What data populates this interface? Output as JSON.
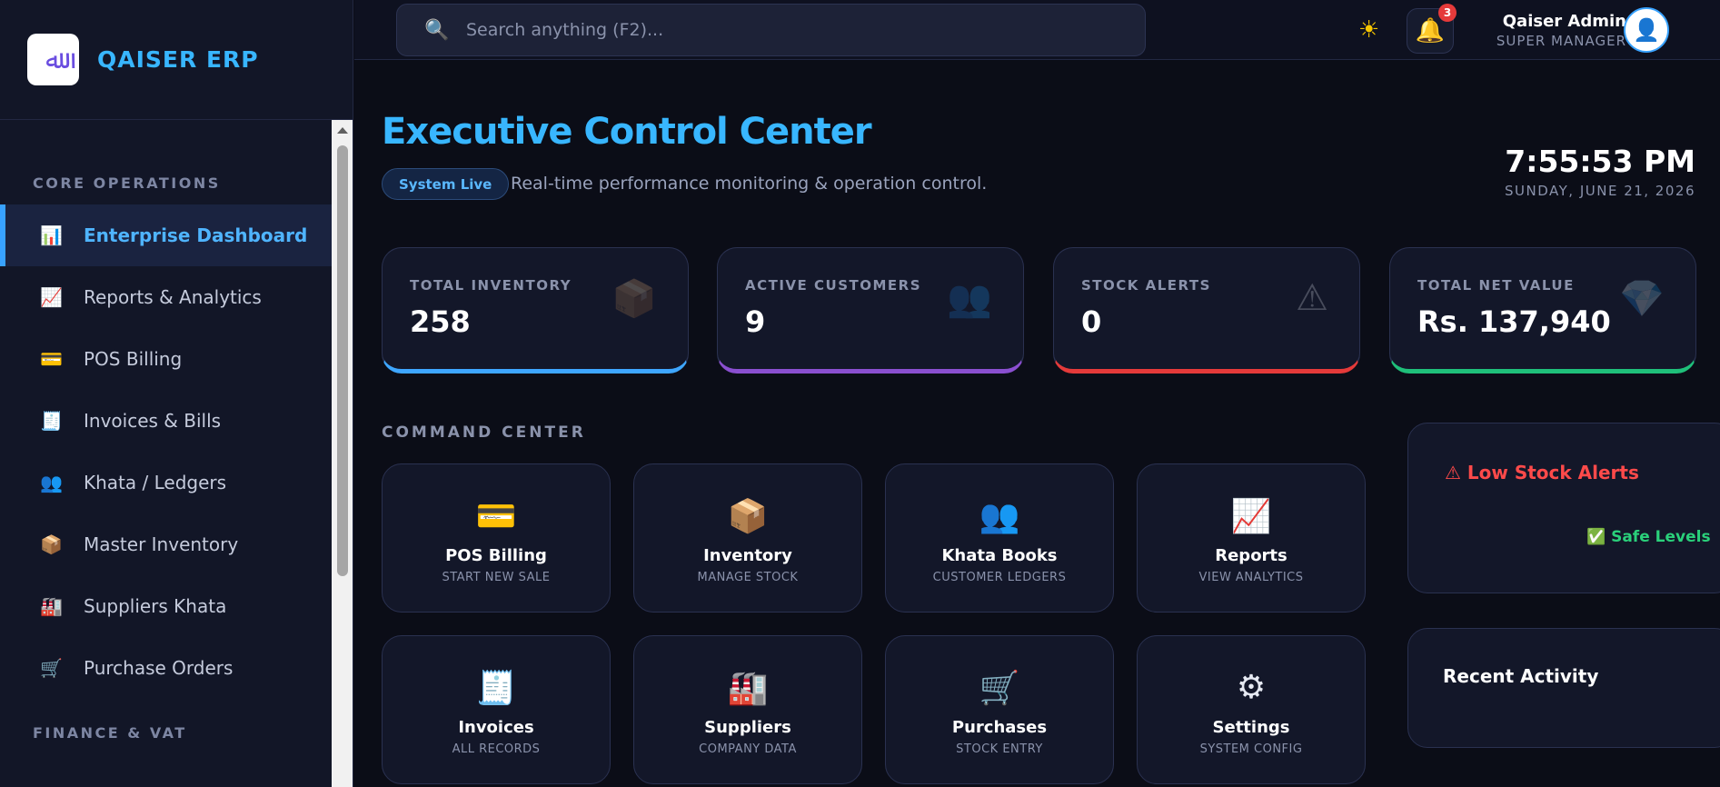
{
  "brand": {
    "logo_glyph": "ﷲ",
    "name": "QAISER ERP"
  },
  "sidebar": {
    "sections": [
      {
        "title": "CORE OPERATIONS",
        "items": [
          {
            "icon": "📊",
            "icon_name": "bar-chart-icon",
            "label": "Enterprise Dashboard",
            "active": true
          },
          {
            "icon": "📈",
            "icon_name": "trend-chart-icon",
            "label": "Reports & Analytics"
          },
          {
            "icon": "💳",
            "icon_name": "credit-card-icon",
            "label": "POS Billing"
          },
          {
            "icon": "🧾",
            "icon_name": "receipt-icon",
            "label": "Invoices & Bills"
          },
          {
            "icon": "👥",
            "icon_name": "people-icon",
            "label": "Khata / Ledgers"
          },
          {
            "icon": "📦",
            "icon_name": "package-icon",
            "label": "Master Inventory"
          },
          {
            "icon": "🏭",
            "icon_name": "factory-icon",
            "label": "Suppliers Khata"
          },
          {
            "icon": "🛒",
            "icon_name": "cart-icon",
            "label": "Purchase Orders"
          }
        ]
      },
      {
        "title": "FINANCE & VAT",
        "items": []
      }
    ]
  },
  "topbar": {
    "search_placeholder": "Search anything (F2)...",
    "notifications_count": "3",
    "user_name": "Qaiser Admin",
    "user_role": "SUPER MANAGER"
  },
  "header": {
    "title": "Executive Control Center",
    "status_badge": "System Live",
    "subtitle": "Real-time performance monitoring & operation control.",
    "time": "7:55:53 PM",
    "date": "SUNDAY, JUNE 21, 2026"
  },
  "stats": [
    {
      "label": "TOTAL INVENTORY",
      "value": "258",
      "icon": "📦",
      "accent": "#3ea6ff"
    },
    {
      "label": "ACTIVE CUSTOMERS",
      "value": "9",
      "icon": "👥",
      "accent": "#8a4fd0"
    },
    {
      "label": "STOCK ALERTS",
      "value": "0",
      "icon": "⚠",
      "accent": "#e53a3a"
    },
    {
      "label": "TOTAL NET VALUE",
      "value": "Rs. 137,940",
      "icon": "💎",
      "accent": "#1fbf7a"
    }
  ],
  "command_center": {
    "title": "COMMAND CENTER",
    "tiles": [
      {
        "icon": "💳",
        "label": "POS Billing",
        "sub": "START NEW SALE"
      },
      {
        "icon": "📦",
        "label": "Inventory",
        "sub": "MANAGE STOCK"
      },
      {
        "icon": "👥",
        "label": "Khata Books",
        "sub": "CUSTOMER LEDGERS"
      },
      {
        "icon": "📈",
        "label": "Reports",
        "sub": "VIEW ANALYTICS"
      },
      {
        "icon": "🧾",
        "label": "Invoices",
        "sub": "ALL RECORDS"
      },
      {
        "icon": "🏭",
        "label": "Suppliers",
        "sub": "COMPANY DATA"
      },
      {
        "icon": "🛒",
        "label": "Purchases",
        "sub": "STOCK ENTRY"
      },
      {
        "icon": "⚙",
        "label": "Settings",
        "sub": "SYSTEM CONFIG"
      }
    ]
  },
  "low_stock": {
    "title": "⚠ Low Stock Alerts",
    "status": "✅ Safe Levels"
  },
  "recent_activity": {
    "title": "Recent Activity"
  }
}
